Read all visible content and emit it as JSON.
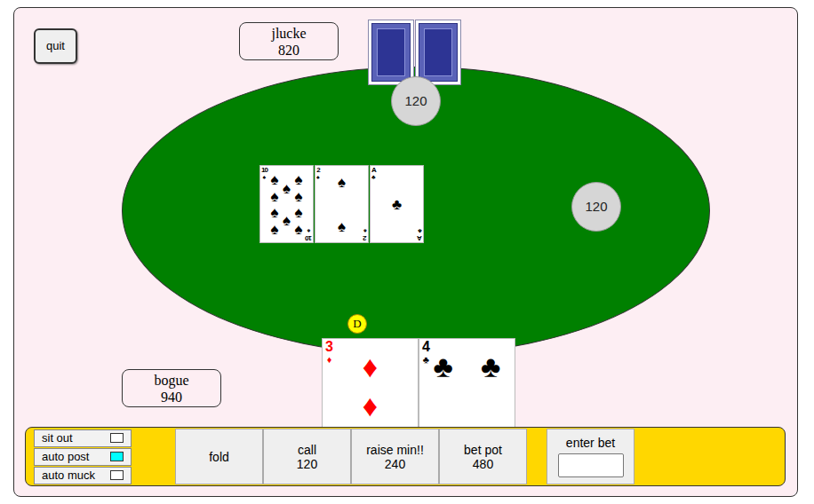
{
  "quit": "quit",
  "opponent": {
    "name": "jlucke",
    "stack": "820",
    "cards": [
      {
        "face_up": false
      },
      {
        "face_up": false
      }
    ]
  },
  "chips": [
    {
      "amount": "120"
    },
    {
      "amount": "120"
    }
  ],
  "board": [
    {
      "rank": "10",
      "suit": "♠",
      "color": "#000000"
    },
    {
      "rank": "2",
      "suit": "♠",
      "color": "#000000"
    },
    {
      "rank": "A",
      "suit": "♣",
      "color": "#000000"
    }
  ],
  "dealer_button": "D",
  "player": {
    "name": "bogue",
    "stack": "940",
    "cards": [
      {
        "rank": "3",
        "suit": "♦",
        "color": "#ff0000"
      },
      {
        "rank": "4",
        "suit": "♣",
        "color": "#000000"
      }
    ]
  },
  "options": [
    {
      "label": "sit out",
      "checked": false
    },
    {
      "label": "auto post",
      "checked": true
    },
    {
      "label": "auto muck",
      "checked": false
    }
  ],
  "actions": [
    {
      "label": "fold",
      "amount": ""
    },
    {
      "label": "call",
      "amount": "120"
    },
    {
      "label": "raise min!!",
      "amount": "240"
    },
    {
      "label": "bet pot",
      "amount": "480"
    }
  ],
  "bet_input": {
    "label": "enter bet",
    "value": ""
  }
}
